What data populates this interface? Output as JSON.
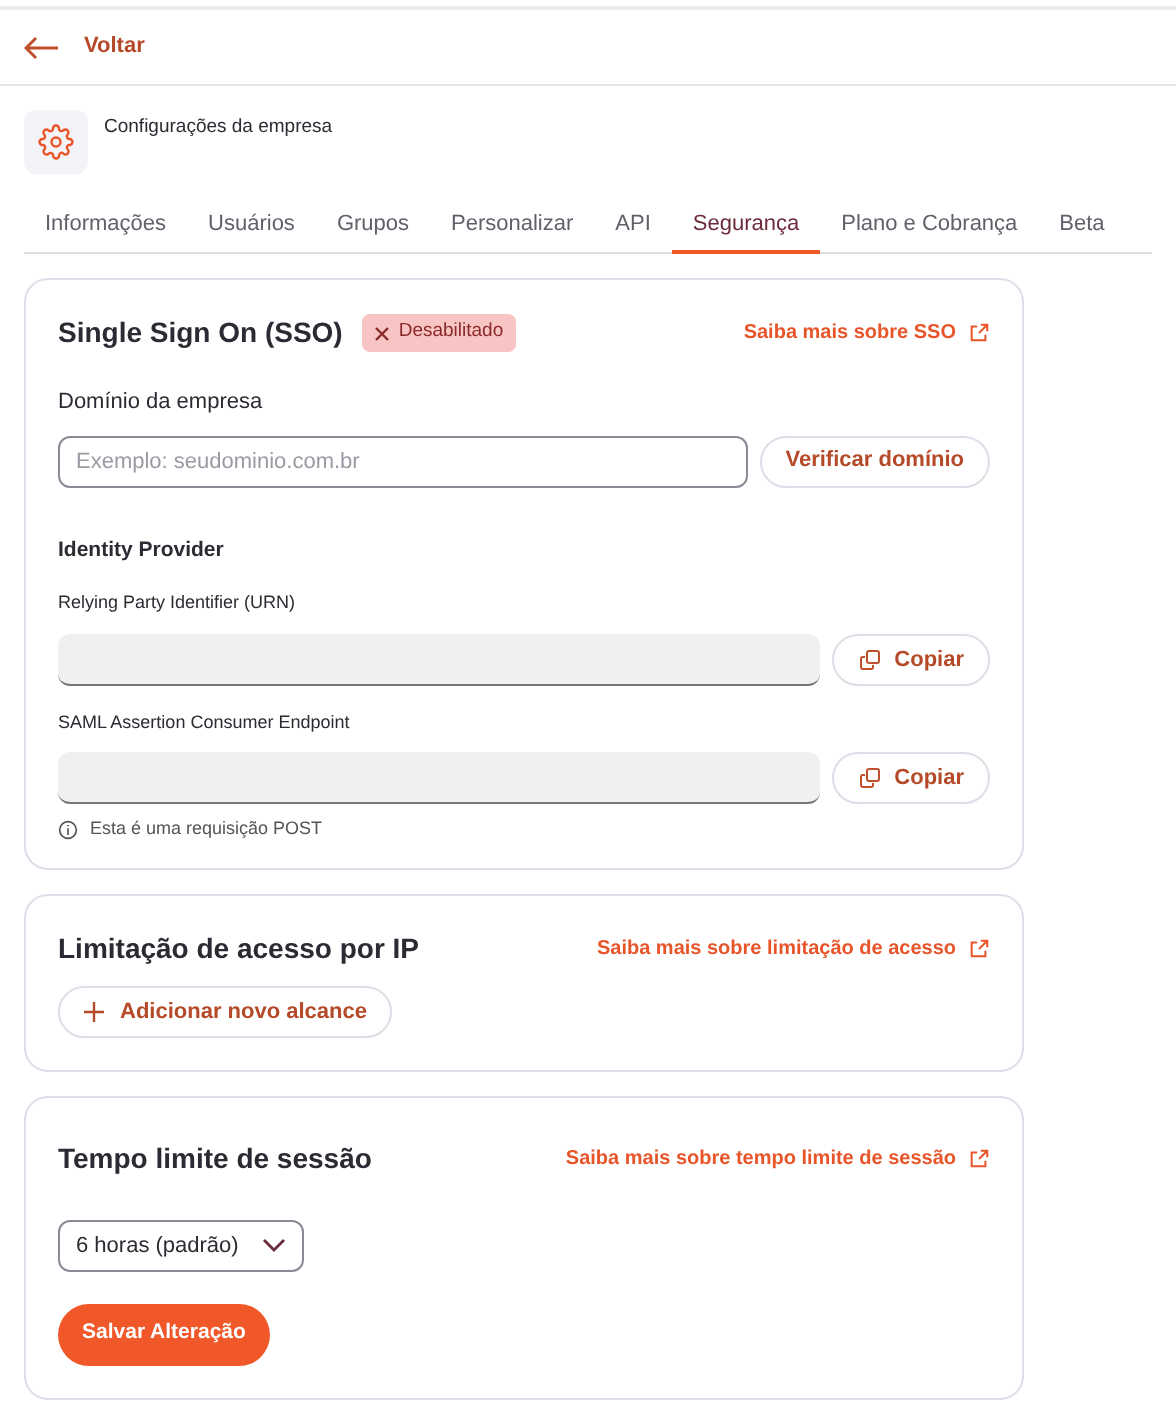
{
  "back": {
    "label": "Voltar"
  },
  "company": {
    "title": "Configurações da empresa"
  },
  "tabs": [
    {
      "label": "Informações",
      "selected": false
    },
    {
      "label": "Usuários",
      "selected": false
    },
    {
      "label": "Grupos",
      "selected": false
    },
    {
      "label": "Personalizar",
      "selected": false
    },
    {
      "label": "API",
      "selected": false
    },
    {
      "label": "Segurança",
      "selected": true
    },
    {
      "label": "Plano e Cobrança",
      "selected": false
    },
    {
      "label": "Beta",
      "selected": false
    }
  ],
  "sso": {
    "title": "Single Sign On (SSO)",
    "status": {
      "label": "Desabilitado",
      "enabled": false
    },
    "link": "Saiba mais sobre SSO",
    "domain_label": "Domínio da empresa",
    "domain_placeholder": "Exemplo: seudominio.com.br",
    "verify_button": "Verificar domínio",
    "idp_title": "Identity Provider",
    "fields": [
      {
        "label": "Relying Party Identifier (URN)",
        "button": "Copiar"
      },
      {
        "label": "SAML Assertion Consumer Endpoint",
        "button": "Copiar"
      }
    ],
    "note": "Esta é uma requisição POST"
  },
  "ip": {
    "title": "Limitação de acesso por IP",
    "link": "Saiba mais sobre limitação de acesso",
    "add_button": "Adicionar novo alcance"
  },
  "session": {
    "title": "Tempo limite de sessão",
    "link": "Saiba mais sobre tempo limite de sessão",
    "select": "6 horas (padrão)",
    "save_button": "Salvar Alteração"
  }
}
